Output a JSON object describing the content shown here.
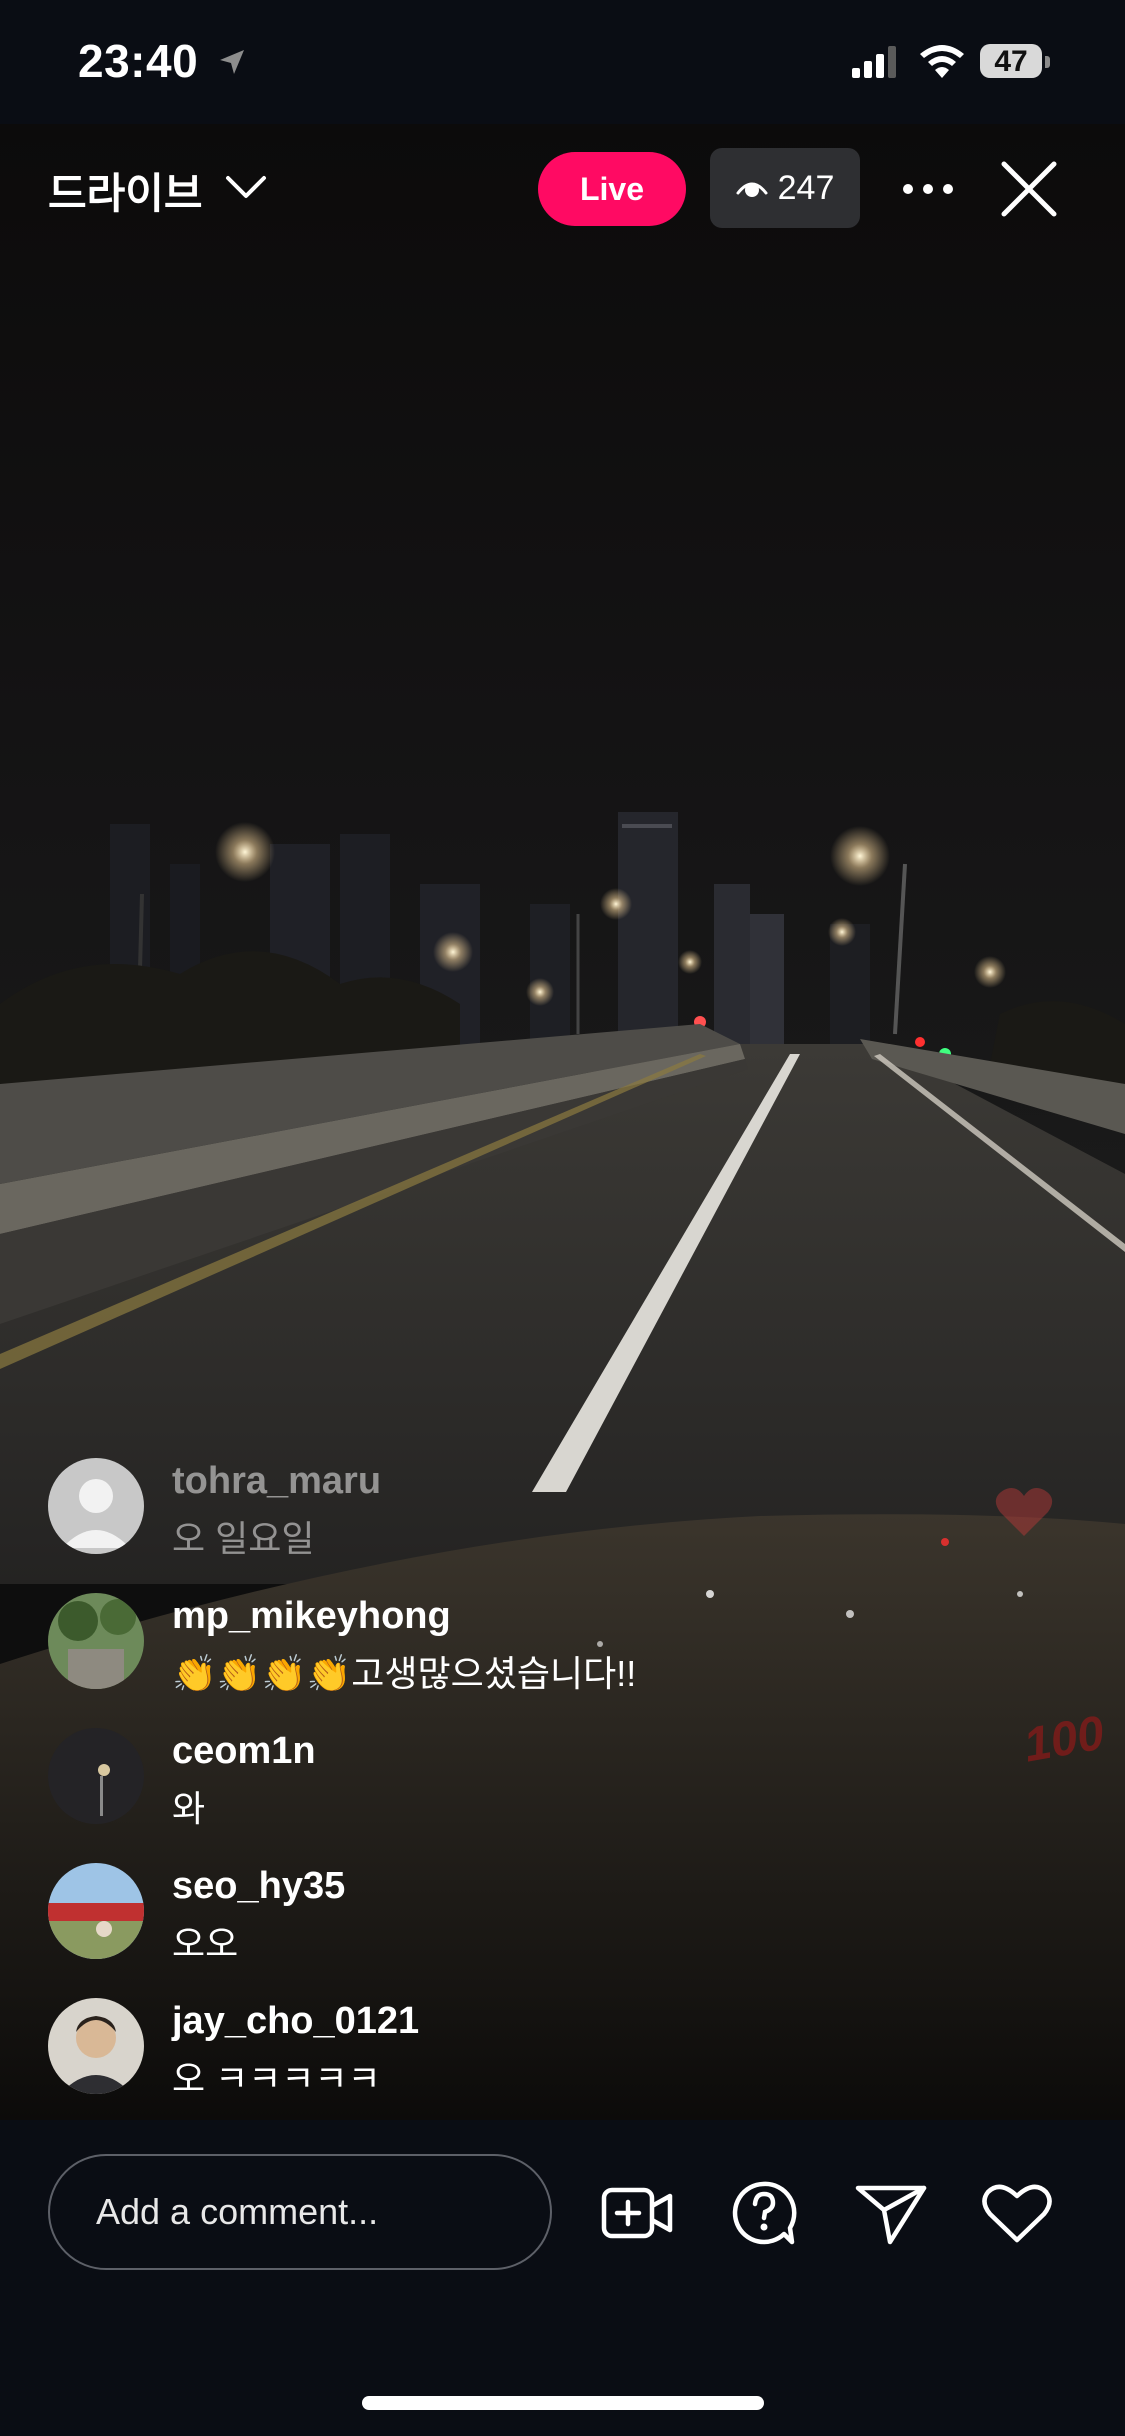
{
  "status_bar": {
    "time": "23:40",
    "battery": "47"
  },
  "header": {
    "title": "드라이브",
    "live_label": "Live",
    "viewer_count": "247"
  },
  "comments": [
    {
      "user": "tohra_maru",
      "text": "오 일요일",
      "faded": true
    },
    {
      "user": "mp_mikeyhong",
      "text": "👏👏👏👏고생많으셨습니다!!"
    },
    {
      "user": "ceom1n",
      "text": "와"
    },
    {
      "user": "seo_hy35",
      "text": "오오"
    },
    {
      "user": "jay_cho_0121",
      "text": "오 ㅋㅋㅋㅋㅋ"
    }
  ],
  "overlay_reactions": {
    "hundred": "100"
  },
  "composer": {
    "placeholder": "Add a comment..."
  },
  "icons": {
    "status": [
      "location-arrow-icon",
      "cellular-signal-icon",
      "wifi-icon",
      "battery-icon"
    ],
    "header": [
      "chevron-down-icon",
      "eye-icon",
      "more-icon",
      "close-icon"
    ],
    "bottom": [
      "add-video-icon",
      "question-icon",
      "send-icon",
      "heart-icon"
    ]
  },
  "colors": {
    "live": "#ff0a63",
    "background": "#0a0d14"
  }
}
